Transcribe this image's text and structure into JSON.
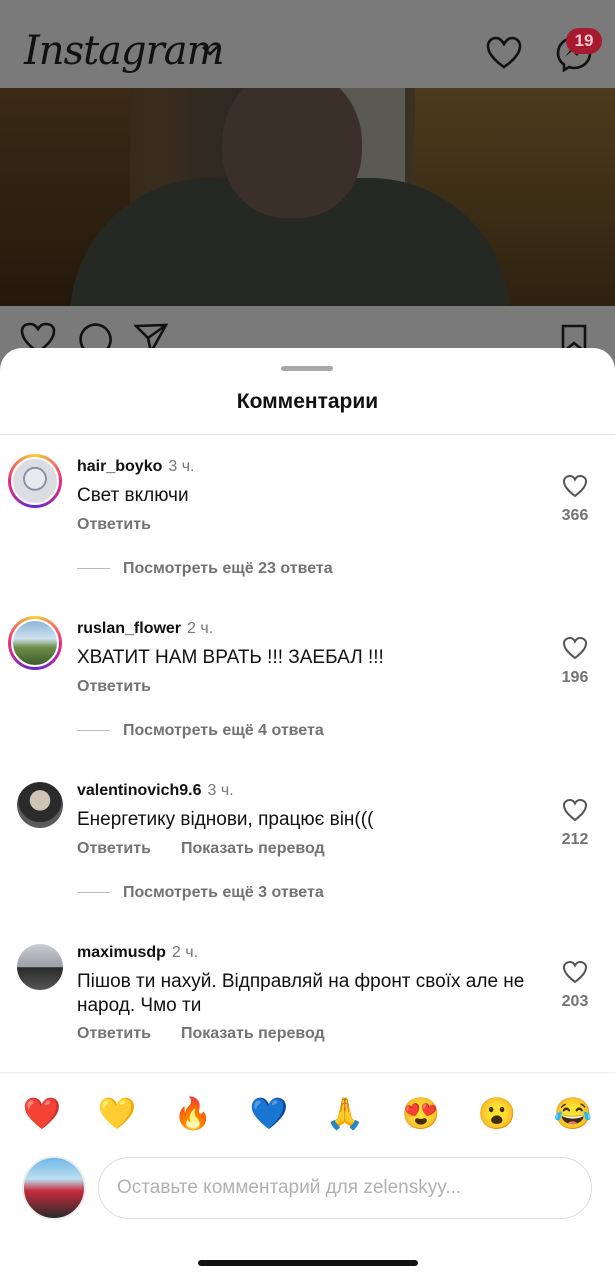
{
  "topbar": {
    "logo": "Instagram",
    "messages_badge": "19"
  },
  "sheet": {
    "title": "Комментарии",
    "comments": [
      {
        "username": "hair_boyko",
        "time": "3 ч.",
        "text": "Свет включи",
        "reply": "Ответить",
        "likes": "366",
        "more_replies": "Посмотреть ещё 23 ответа"
      },
      {
        "username": "ruslan_flower",
        "time": "2 ч.",
        "text": "ХВАТИТ НАМ ВРАТЬ !!! ЗАЕБАЛ !!!",
        "reply": "Ответить",
        "likes": "196",
        "more_replies": "Посмотреть ещё 4 ответа"
      },
      {
        "username": "valentinovich9.6",
        "time": "3 ч.",
        "text": "Енергетику віднови, працює він(((",
        "reply": "Ответить",
        "translate": "Показать перевод",
        "likes": "212",
        "more_replies": "Посмотреть ещё 3 ответа"
      },
      {
        "username": "maximusdp",
        "time": "2 ч.",
        "text": "Пішов ти нахуй. Відправляй на фронт своїх але не народ. Чмо ти",
        "reply": "Ответить",
        "translate": "Показать перевод",
        "likes": "203"
      }
    ],
    "reactions": [
      "❤️",
      "💛",
      "🔥",
      "💙",
      "🙏",
      "😍",
      "😮",
      "😂"
    ],
    "input": {
      "placeholder": "Оставьте комментарий для zelenskyy...",
      "value": ""
    }
  },
  "colors": {
    "badge": "#a6192e",
    "muted": "#737373",
    "story_ring": "#ee2a7b"
  }
}
